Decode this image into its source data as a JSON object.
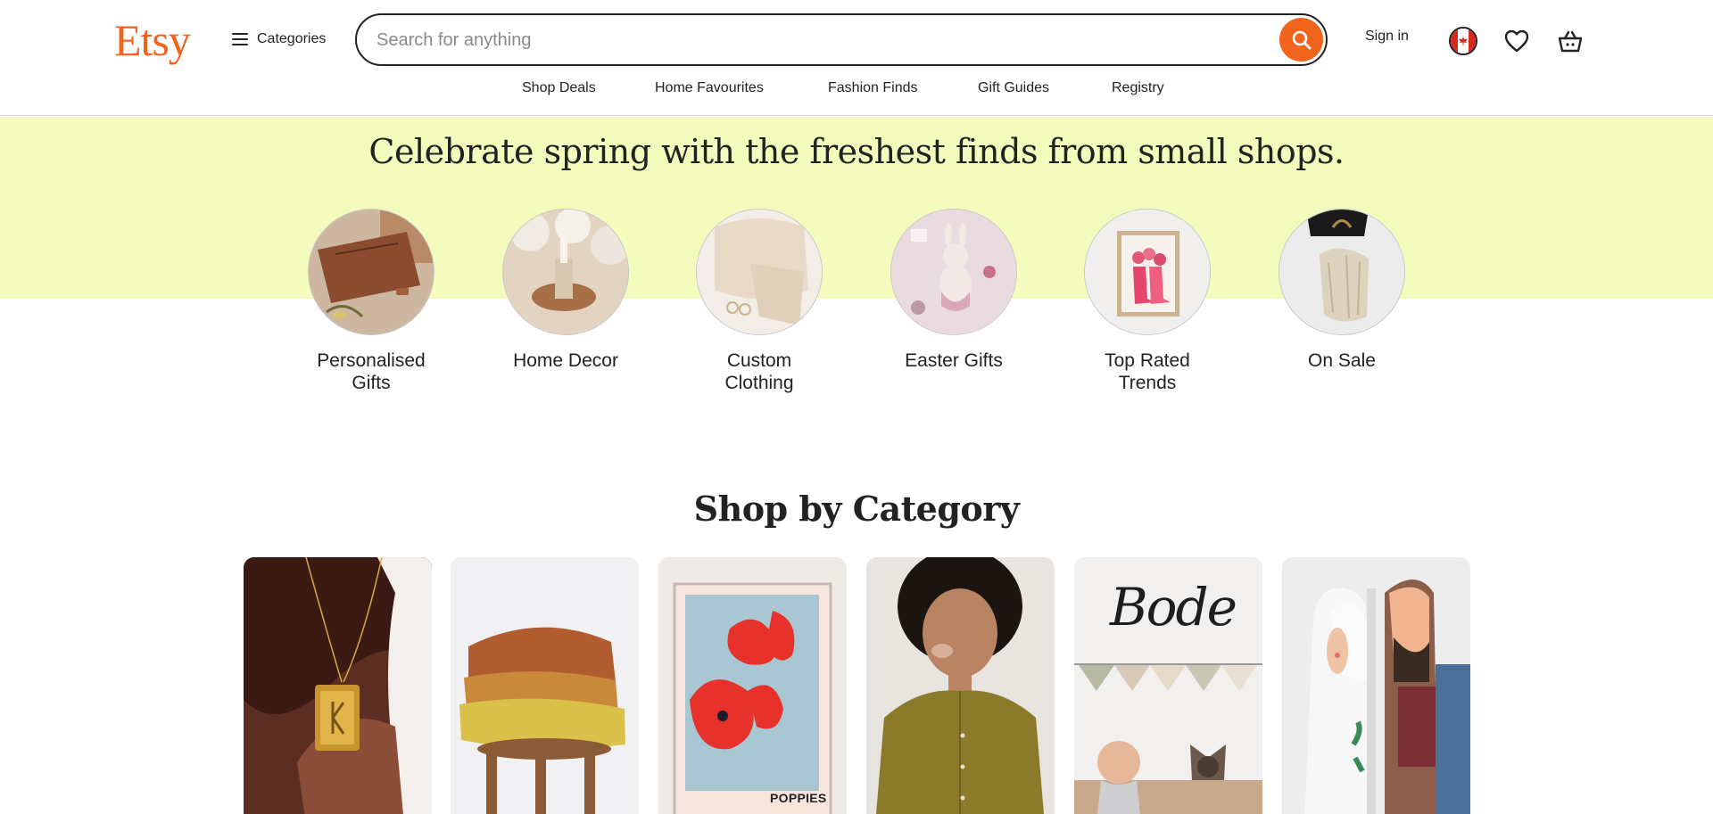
{
  "header": {
    "logo": "Etsy",
    "categories_label": "Categories",
    "search_placeholder": "Search for anything",
    "sign_in": "Sign in"
  },
  "nav": [
    "Shop Deals",
    "Home Favourites",
    "Fashion Finds",
    "Gift Guides",
    "Registry"
  ],
  "hero": {
    "title": "Celebrate spring with the freshest finds from small shops.",
    "categories": [
      {
        "label_line1": "Personalised",
        "label_line2": "Gifts"
      },
      {
        "label_line1": "Home Decor",
        "label_line2": ""
      },
      {
        "label_line1": "Custom",
        "label_line2": "Clothing"
      },
      {
        "label_line1": "Easter Gifts",
        "label_line2": ""
      },
      {
        "label_line1": "Top Rated",
        "label_line2": "Trends"
      },
      {
        "label_line1": "On Sale",
        "label_line2": ""
      }
    ]
  },
  "shop_by_category": {
    "title": "Shop by Category",
    "tile_texts": {
      "bode": "Bode",
      "poppies": "POPPIES"
    }
  },
  "colors": {
    "brand": "#f1641e",
    "hero_band": "#f3fcbd",
    "text": "#222222"
  },
  "icons": [
    "hamburger-icon",
    "search-icon",
    "canada-flag-icon",
    "heart-icon",
    "shopping-bag-icon"
  ]
}
